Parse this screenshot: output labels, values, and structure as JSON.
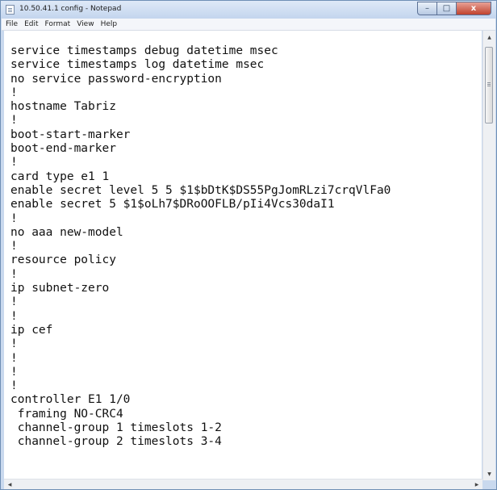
{
  "window": {
    "title": "10.50.41.1 config - Notepad",
    "controls": {
      "minimize": "–",
      "maximize": "□",
      "close": "x"
    }
  },
  "menu": [
    "File",
    "Edit",
    "Format",
    "View",
    "Help"
  ],
  "editor": {
    "lines": [
      "service timestamps debug datetime msec",
      "service timestamps log datetime msec",
      "no service password-encryption",
      "!",
      "hostname Tabriz",
      "!",
      "boot-start-marker",
      "boot-end-marker",
      "!",
      "card type e1 1",
      "enable secret level 5 5 $1$bDtK$DS55PgJomRLzi7crqVlFa0",
      "enable secret 5 $1$oLh7$DRoOOFLB/pIi4Vcs30daI1",
      "!",
      "no aaa new-model",
      "!",
      "resource policy",
      "!",
      "ip subnet-zero",
      "!",
      "!",
      "ip cef",
      "!",
      "!",
      "!",
      "!",
      "controller E1 1/0",
      " framing NO-CRC4",
      " channel-group 1 timeslots 1-2",
      " channel-group 2 timeslots 3-4"
    ]
  },
  "scrollbar": {
    "arrow_up": "▲",
    "arrow_down": "▼",
    "arrow_left": "◀",
    "arrow_right": "▶"
  }
}
